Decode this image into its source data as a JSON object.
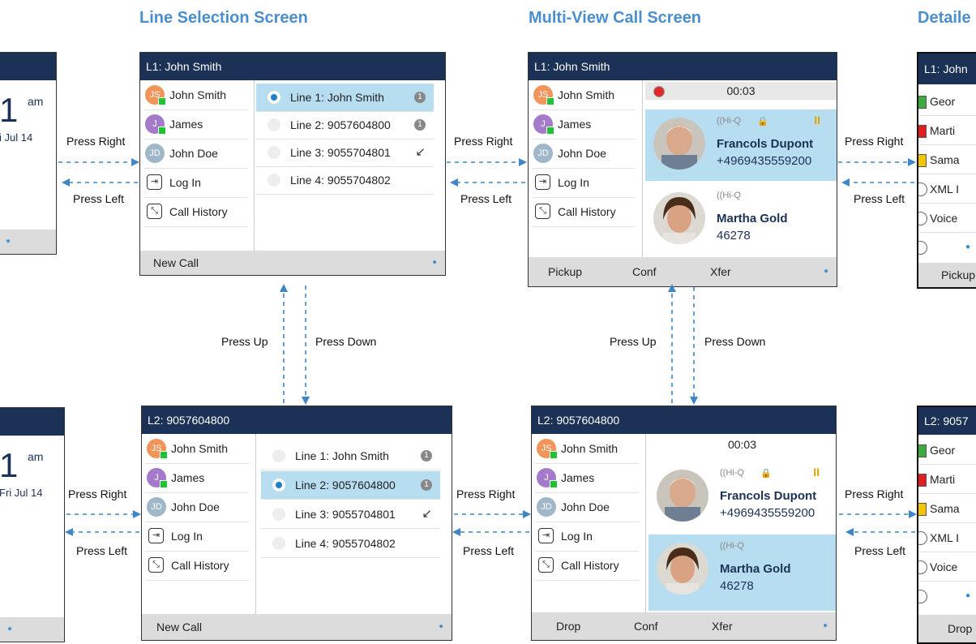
{
  "titles": {
    "line_selection": "Line Selection Screen",
    "multi_view": "Multi-View Call Screen",
    "detailed": "Detaile"
  },
  "labels": {
    "press_right": "Press Right",
    "press_left": "Press Left",
    "press_up": "Press Up",
    "press_down": "Press Down"
  },
  "contacts": [
    {
      "initials": "JS",
      "name": "John Smith"
    },
    {
      "initials": "J",
      "name": "James"
    },
    {
      "initials": "JD",
      "name": "John Doe"
    },
    {
      "name": "Log In"
    },
    {
      "name": "Call History"
    }
  ],
  "top_left_screen": {
    "header": "L1: John Smith",
    "lines": [
      {
        "label": "Line 1: John Smith",
        "badge": "1"
      },
      {
        "label": "Line 2: 9057604800",
        "badge": "1"
      },
      {
        "label": "Line 3: 9055704801",
        "icon": "missed-call-icon",
        "glyph": "↙"
      },
      {
        "label": "Line 4: 9055704802"
      }
    ],
    "softkey": "New Call"
  },
  "bottom_left_screen": {
    "header": "L2: 9057604800",
    "lines": [
      {
        "label": "Line 1: John Smith",
        "badge": "1"
      },
      {
        "label": "Line 2: 9057604800",
        "badge": "1"
      },
      {
        "label": "Line 3: 9055704801",
        "icon": "missed-call-icon",
        "glyph": "↙"
      },
      {
        "label": "Line 4: 9055704802"
      }
    ],
    "softkey": "New Call"
  },
  "top_mid_screen": {
    "header": "L1: John Smith",
    "timer": "00:03",
    "calls": [
      {
        "hiq": "((Hi-Q",
        "lock": "🔒",
        "pause": "II",
        "name": "Francols Dupont",
        "number": "+4969435559200"
      },
      {
        "hiq": "((Hi-Q",
        "name": "Martha Gold",
        "number": "46278"
      }
    ],
    "softkeys": [
      "Pickup",
      "Conf",
      "Xfer"
    ]
  },
  "bottom_mid_screen": {
    "header": "L2: 9057604800",
    "timer": "00:03",
    "calls": [
      {
        "hiq": "((Hi-Q",
        "lock": "🔒",
        "pause": "II",
        "name": "Francols Dupont",
        "number": "+4969435559200"
      },
      {
        "hiq": "((Hi-Q",
        "name": "Martha Gold",
        "number": "46278"
      }
    ],
    "softkeys": [
      "Drop",
      "Conf",
      "Xfer"
    ]
  },
  "left_clock": {
    "top": {
      "time": "1",
      "ampm": "am",
      "date": "i Jul 14"
    },
    "bottom": {
      "time": "1",
      "ampm": "am",
      "date": "Fri Jul 14"
    }
  },
  "right_top_screen": {
    "header": "L1: John",
    "rows": [
      {
        "label": "Geor",
        "color": "#3caa3c"
      },
      {
        "label": "Marti",
        "color": "#e01e1e"
      },
      {
        "label": "Sama",
        "color": "#f3c400"
      },
      {
        "label": "XML I"
      },
      {
        "label": "Voice"
      }
    ],
    "softkey": "Pickup"
  },
  "right_bottom_screen": {
    "header": "L2: 9057",
    "rows": [
      {
        "label": "Geor",
        "color": "#3caa3c"
      },
      {
        "label": "Marti",
        "color": "#e01e1e"
      },
      {
        "label": "Sama",
        "color": "#f3c400"
      },
      {
        "label": "XML I"
      },
      {
        "label": "Voice"
      }
    ],
    "softkey": "Drop"
  },
  "colors": {
    "header_bg": "#1b3156",
    "title": "#4a8fcf",
    "selection": "#b7ddf0",
    "arrow": "#3f86c6"
  }
}
